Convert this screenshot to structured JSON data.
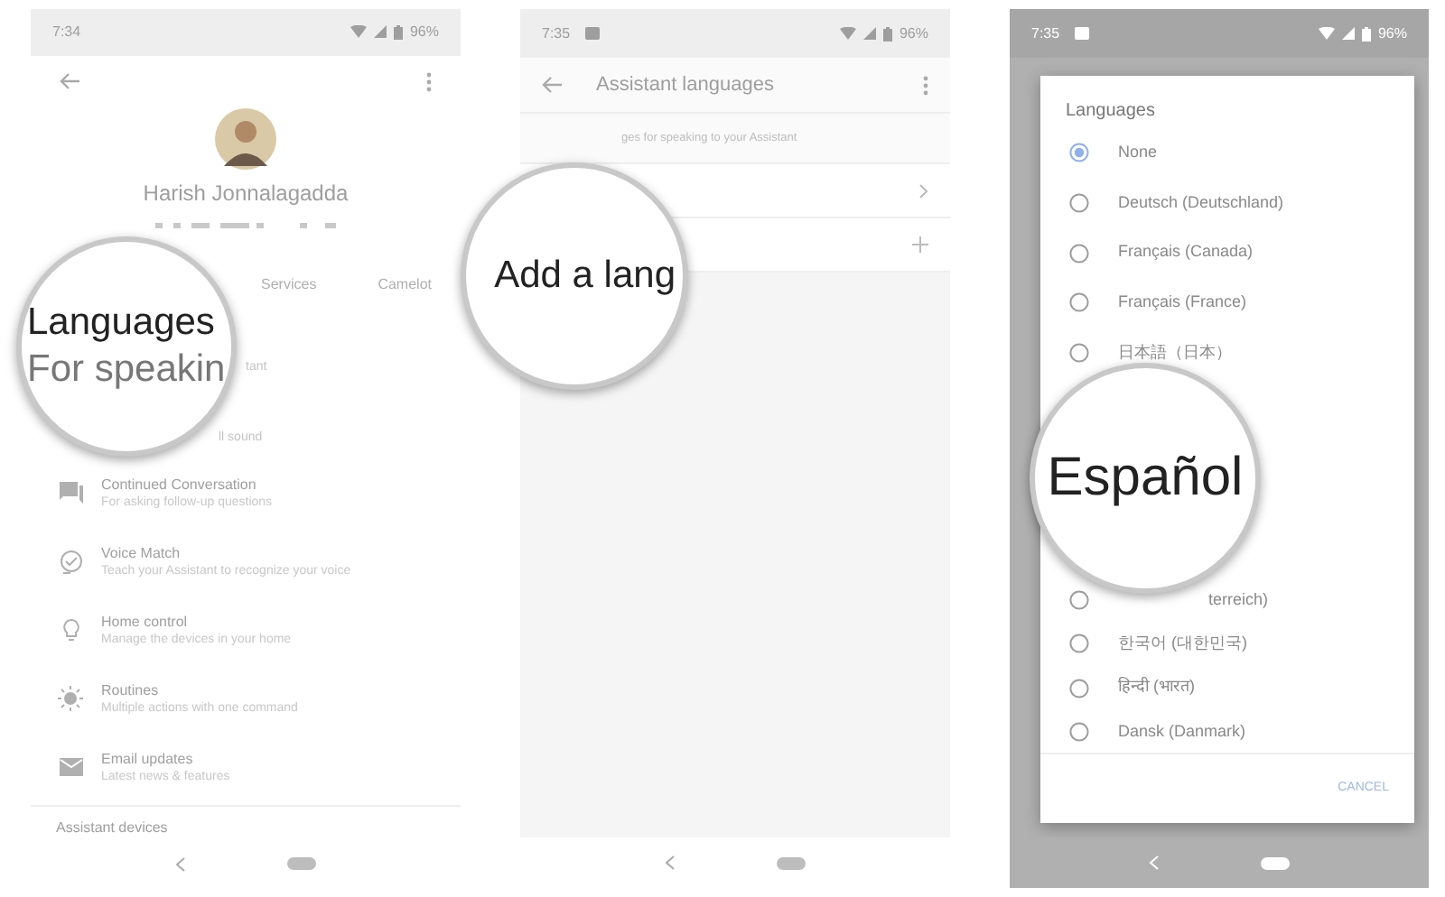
{
  "screens": [
    {
      "status_bar": {
        "time": "7:34",
        "battery": "96%"
      },
      "profile": {
        "name": "Harish Jonnalagadda"
      },
      "tabs": [
        {
          "label": "Services"
        },
        {
          "label": "Camelot"
        }
      ],
      "fragments": [
        "tant",
        "ll sound"
      ],
      "settings": [
        {
          "kind": "conversation",
          "title": "Continued Conversation",
          "subtitle": "For asking follow-up questions"
        },
        {
          "kind": "voice",
          "title": "Voice Match",
          "subtitle": "Teach your Assistant to recognize your voice"
        },
        {
          "kind": "home",
          "title": "Home control",
          "subtitle": "Manage the devices in your home"
        },
        {
          "kind": "routines",
          "title": "Routines",
          "subtitle": "Multiple actions with one command"
        },
        {
          "kind": "email",
          "title": "Email updates",
          "subtitle": "Latest news & features"
        }
      ],
      "section_header": "Assistant devices",
      "magnifier": {
        "lines": [
          "Languages",
          "For speakin"
        ]
      }
    },
    {
      "status_bar": {
        "time": "7:35",
        "battery": "96%"
      },
      "toolbar": {
        "title": "Assistant languages"
      },
      "caption": "ges for speaking to your Assistant",
      "rows": [
        {
          "kind": "chevron"
        },
        {
          "kind": "plus"
        }
      ],
      "magnifier": {
        "lines": [
          "Add a lang"
        ]
      }
    },
    {
      "status_bar": {
        "time": "7:35",
        "battery": "96%"
      },
      "dialog": {
        "title": "Languages",
        "options": [
          {
            "label": "None",
            "selected": true
          },
          {
            "label": "Deutsch (Deutschland)",
            "selected": false
          },
          {
            "label": "Français (Canada)",
            "selected": false
          },
          {
            "label": "Français (France)",
            "selected": false
          },
          {
            "label": "日本語（日本）",
            "selected": false
          }
        ],
        "more_options": [
          {
            "label": "terreich)",
            "selected": false
          },
          {
            "label": "한국어 (대한민국)",
            "selected": false
          },
          {
            "label": "हिन्दी (भारत)",
            "selected": false
          },
          {
            "label": "Dansk (Danmark)",
            "selected": false
          }
        ],
        "cancel": "CANCEL"
      },
      "magnifier": {
        "lines": [
          "Español"
        ]
      }
    }
  ]
}
